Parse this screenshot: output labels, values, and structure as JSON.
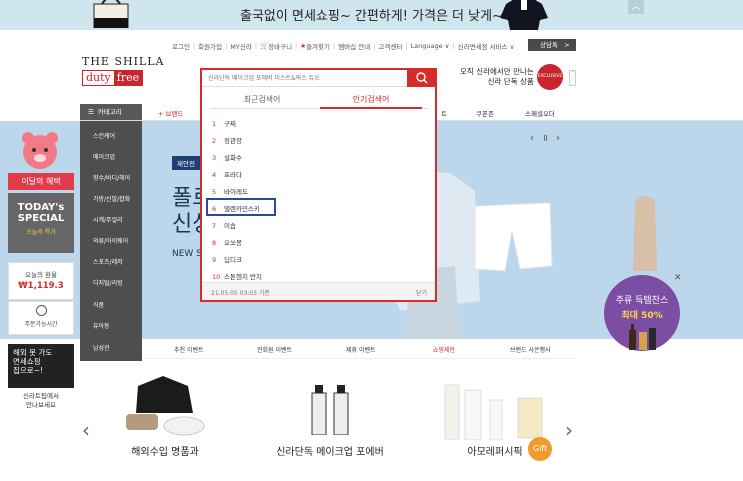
{
  "top_banner": {
    "text": "출국없이 면세쇼핑~ 간편하게! 가격은 더 낮게~"
  },
  "util_nav": {
    "items": [
      "로그인",
      "회원가입",
      "MY신라",
      "장바구니",
      "즐겨찾기",
      "멤버십 안내",
      "고객센터",
      "Language ∨",
      "신라면세점 서비스 ∨"
    ],
    "membership_button": "상담톡"
  },
  "logo": {
    "top": "THE SHILLA",
    "left": "duty",
    "right": "free"
  },
  "header_promo": {
    "line1": "오직 신라에서만 만나는",
    "line2": "신라 단독 상품",
    "badge": "EXCLUSIVE"
  },
  "gnb": {
    "category_button": "카테고리",
    "brand": "+ 브랜드",
    "items": [
      "트",
      "쿠폰존",
      "스페셜오더"
    ]
  },
  "hero": {
    "tag": "제안전",
    "title1": "폴르",
    "title2": "신상",
    "subtitle": "NEW S"
  },
  "left_sidebar": {
    "monthly": "이달의 혜택",
    "today_line1": "TODAY's",
    "today_line2": "SPECIAL",
    "today_sub": "오늘의 특가",
    "rate_label": "오늘의 환율",
    "rate_value": "₩1,119.3",
    "hours_label": "주문가능시간",
    "abroad": [
      "해외 못 가도",
      "면세쇼핑",
      "집으로~!"
    ],
    "trip": [
      "신라트립에서",
      "만나보세요"
    ]
  },
  "category_menu": [
    "스킨케어",
    "메이크업",
    "향수/바디/헤어",
    "가방/신발/잡화",
    "시계/주얼리",
    "의류/아이웨어",
    "스포츠/레저",
    "디지털/리빙",
    "식품",
    "유아동",
    "남성관"
  ],
  "event_tabs": [
    "추천 이벤트",
    "전회원 이벤트",
    "제휴 이벤트",
    "쇼핑제안",
    "브랜드 사은행사"
  ],
  "side_promo": {
    "line1": "주류 득템찬스",
    "line2": "최대 50%"
  },
  "products": [
    {
      "name": "해외수입 명품과"
    },
    {
      "name": "신라단독 메이크업 포에버"
    },
    {
      "name": "아모레퍼시픽"
    }
  ],
  "gift_badge": "Gift",
  "search": {
    "placeholder": "신라단독 메이크업 포에버 미스트&픽스 듀오",
    "tab_recent": "최근검색어",
    "tab_popular": "인기검색어",
    "keywords": [
      {
        "rank": "1",
        "word": "구찌"
      },
      {
        "rank": "2",
        "word": "정관장"
      },
      {
        "rank": "3",
        "word": "설화수"
      },
      {
        "rank": "4",
        "word": "프라다"
      },
      {
        "rank": "5",
        "word": "바이레도"
      },
      {
        "rank": "6",
        "word": "델렌카민스키"
      },
      {
        "rank": "7",
        "word": "이솝"
      },
      {
        "rank": "8",
        "word": "오쏘몽"
      },
      {
        "rank": "9",
        "word": "딥디크"
      },
      {
        "rank": "10",
        "word": "스톤헨지 반지"
      }
    ],
    "date": "21.05.05 03:03 기준",
    "close": "닫기"
  },
  "colors": {
    "accent": "#d52b2b",
    "brand_red": "#c9252c",
    "highlight": "#2b4a9c"
  }
}
